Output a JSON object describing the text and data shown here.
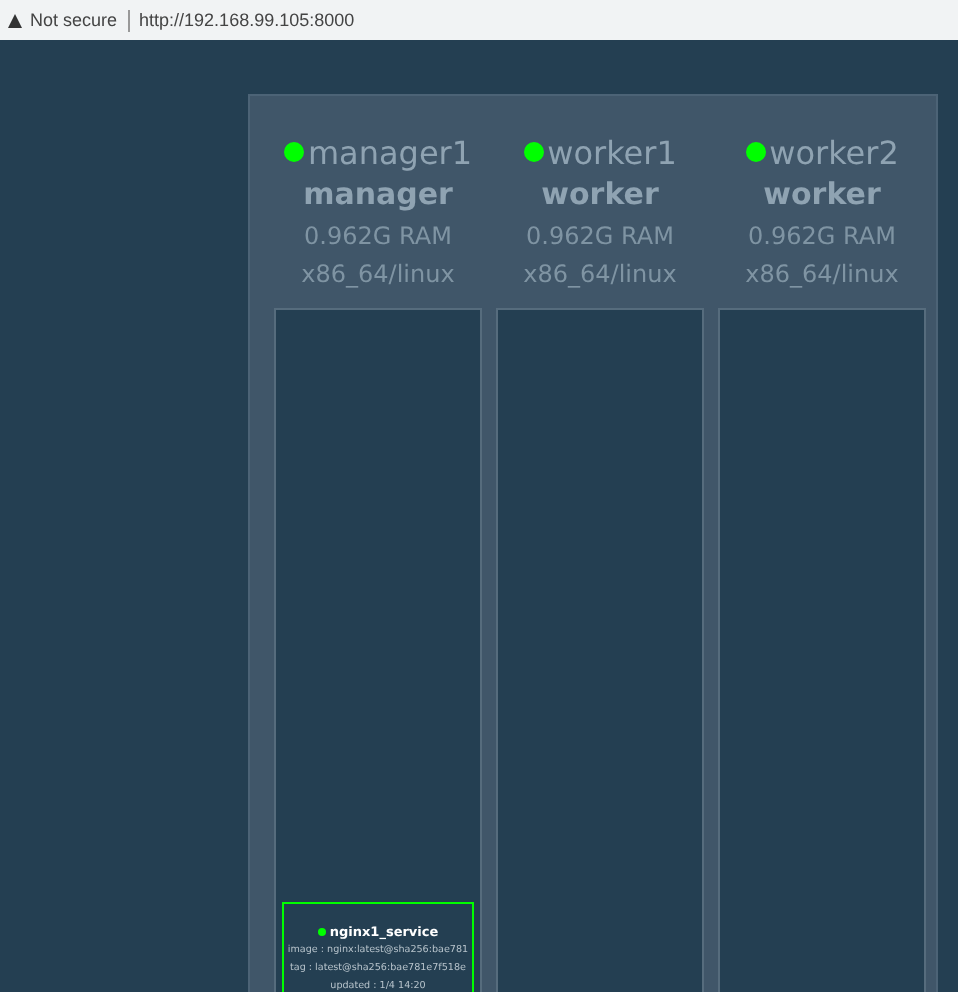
{
  "address_bar": {
    "security": "Not secure",
    "url": "http://192.168.99.105:8000"
  },
  "nodes": [
    {
      "name": "manager1",
      "role": "manager",
      "ram": "0.962G RAM",
      "platform": "x86_64/linux",
      "color": "#00ff00",
      "services": [
        {
          "name": "nginx1_service",
          "color": "#00ff00",
          "lines": [
            "image : nginx:latest@sha256:bae781",
            "tag : latest@sha256:bae781e7f518e",
            "updated : 1/4 14:20"
          ]
        }
      ]
    },
    {
      "name": "worker1",
      "role": "worker",
      "ram": "0.962G RAM",
      "platform": "x86_64/linux",
      "color": "#00ff00"
    },
    {
      "name": "worker2",
      "role": "worker",
      "ram": "0.962G RAM",
      "platform": "x86_64/linux",
      "color": "#00ff00"
    }
  ]
}
